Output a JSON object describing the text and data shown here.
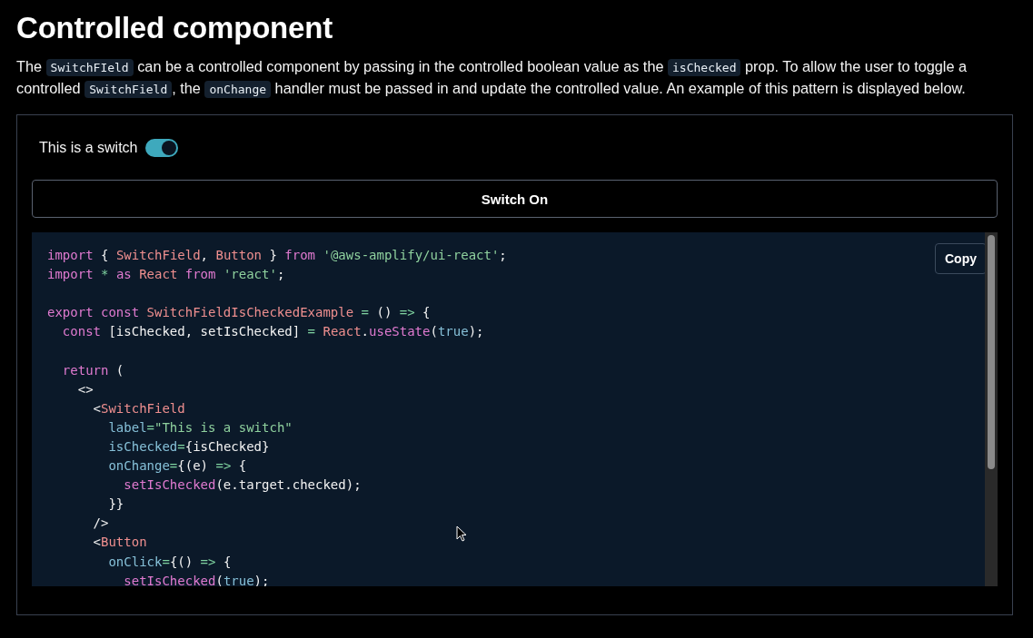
{
  "heading": "Controlled component",
  "description": [
    {
      "kind": "text",
      "text": "The "
    },
    {
      "kind": "code",
      "text": "SwitchFIeld"
    },
    {
      "kind": "text",
      "text": " can be a controlled component by passing in the controlled boolean value as the "
    },
    {
      "kind": "code",
      "text": "isChecked"
    },
    {
      "kind": "text",
      "text": " prop. To allow the user to toggle a controlled "
    },
    {
      "kind": "code",
      "text": "SwitchField"
    },
    {
      "kind": "text",
      "text": ", the "
    },
    {
      "kind": "code",
      "text": "onChange"
    },
    {
      "kind": "text",
      "text": " handler must be passed in and update the controlled value. An example of this pattern is displayed below."
    }
  ],
  "demo": {
    "switch": {
      "label": "This is a switch",
      "checked": true
    },
    "button": "Switch On"
  },
  "code": {
    "copy_button": "Copy",
    "lines": [
      {
        "kind": "code",
        "tokens": [
          {
            "kind": "kw",
            "text": "import"
          },
          {
            "kind": "plain",
            "text": " { "
          },
          {
            "kind": "name",
            "text": "SwitchField"
          },
          {
            "kind": "plain",
            "text": ", "
          },
          {
            "kind": "name",
            "text": "Button"
          },
          {
            "kind": "plain",
            "text": " } "
          },
          {
            "kind": "kw",
            "text": "from "
          },
          {
            "kind": "str",
            "text": "'@aws-amplify/ui-react'"
          },
          {
            "kind": "plain",
            "text": ";"
          }
        ]
      },
      {
        "kind": "code",
        "tokens": [
          {
            "kind": "kw",
            "text": "import "
          },
          {
            "kind": "op",
            "text": "* "
          },
          {
            "kind": "kw",
            "text": "as "
          },
          {
            "kind": "name",
            "text": "React "
          },
          {
            "kind": "kw",
            "text": "from "
          },
          {
            "kind": "str",
            "text": "'react'"
          },
          {
            "kind": "plain",
            "text": ";"
          }
        ]
      },
      {
        "kind": "blank"
      },
      {
        "kind": "code",
        "tokens": [
          {
            "kind": "kw",
            "text": "export const "
          },
          {
            "kind": "name",
            "text": "SwitchFieldIsCheckedExample "
          },
          {
            "kind": "op",
            "text": "= "
          },
          {
            "kind": "plain",
            "text": "() "
          },
          {
            "kind": "op",
            "text": "=> "
          },
          {
            "kind": "plain",
            "text": "{"
          }
        ]
      },
      {
        "kind": "code",
        "tokens": [
          {
            "kind": "kw",
            "text": "  const"
          },
          {
            "kind": "plain",
            "text": " [isChecked, setIsChecked] "
          },
          {
            "kind": "op",
            "text": "= "
          },
          {
            "kind": "name",
            "text": "React"
          },
          {
            "kind": "plain",
            "text": "."
          },
          {
            "kind": "fn",
            "text": "useState"
          },
          {
            "kind": "plain",
            "text": "("
          },
          {
            "kind": "attr",
            "text": "true"
          },
          {
            "kind": "plain",
            "text": ");"
          }
        ]
      },
      {
        "kind": "blank"
      },
      {
        "kind": "code",
        "tokens": [
          {
            "kind": "kw",
            "text": "  return"
          },
          {
            "kind": "plain",
            "text": " ("
          }
        ]
      },
      {
        "kind": "code",
        "tokens": [
          {
            "kind": "plain",
            "text": "    <>"
          }
        ]
      },
      {
        "kind": "code",
        "tokens": [
          {
            "kind": "plain",
            "text": "      <"
          },
          {
            "kind": "name",
            "text": "SwitchField"
          }
        ]
      },
      {
        "kind": "code",
        "tokens": [
          {
            "kind": "attr",
            "text": "        label"
          },
          {
            "kind": "op",
            "text": "="
          },
          {
            "kind": "str",
            "text": "\"This is a switch\""
          }
        ]
      },
      {
        "kind": "code",
        "tokens": [
          {
            "kind": "attr",
            "text": "        isChecked"
          },
          {
            "kind": "op",
            "text": "="
          },
          {
            "kind": "plain",
            "text": "{isChecked}"
          }
        ]
      },
      {
        "kind": "code",
        "tokens": [
          {
            "kind": "attr",
            "text": "        onChange"
          },
          {
            "kind": "op",
            "text": "="
          },
          {
            "kind": "plain",
            "text": "{(e) "
          },
          {
            "kind": "op",
            "text": "=> "
          },
          {
            "kind": "plain",
            "text": "{"
          }
        ]
      },
      {
        "kind": "code",
        "tokens": [
          {
            "kind": "fn",
            "text": "          setIsChecked"
          },
          {
            "kind": "plain",
            "text": "(e.target.checked);"
          }
        ]
      },
      {
        "kind": "code",
        "tokens": [
          {
            "kind": "plain",
            "text": "        }}"
          }
        ]
      },
      {
        "kind": "code",
        "tokens": [
          {
            "kind": "plain",
            "text": "      />"
          }
        ]
      },
      {
        "kind": "code",
        "tokens": [
          {
            "kind": "plain",
            "text": "      <"
          },
          {
            "kind": "name",
            "text": "Button"
          }
        ]
      },
      {
        "kind": "code",
        "tokens": [
          {
            "kind": "attr",
            "text": "        onClick"
          },
          {
            "kind": "op",
            "text": "="
          },
          {
            "kind": "plain",
            "text": "{() "
          },
          {
            "kind": "op",
            "text": "=> "
          },
          {
            "kind": "plain",
            "text": "{"
          }
        ]
      },
      {
        "kind": "code",
        "tokens": [
          {
            "kind": "fn",
            "text": "          setIsChecked"
          },
          {
            "kind": "plain",
            "text": "("
          },
          {
            "kind": "attr",
            "text": "true"
          },
          {
            "kind": "plain",
            "text": ");"
          }
        ]
      }
    ]
  }
}
